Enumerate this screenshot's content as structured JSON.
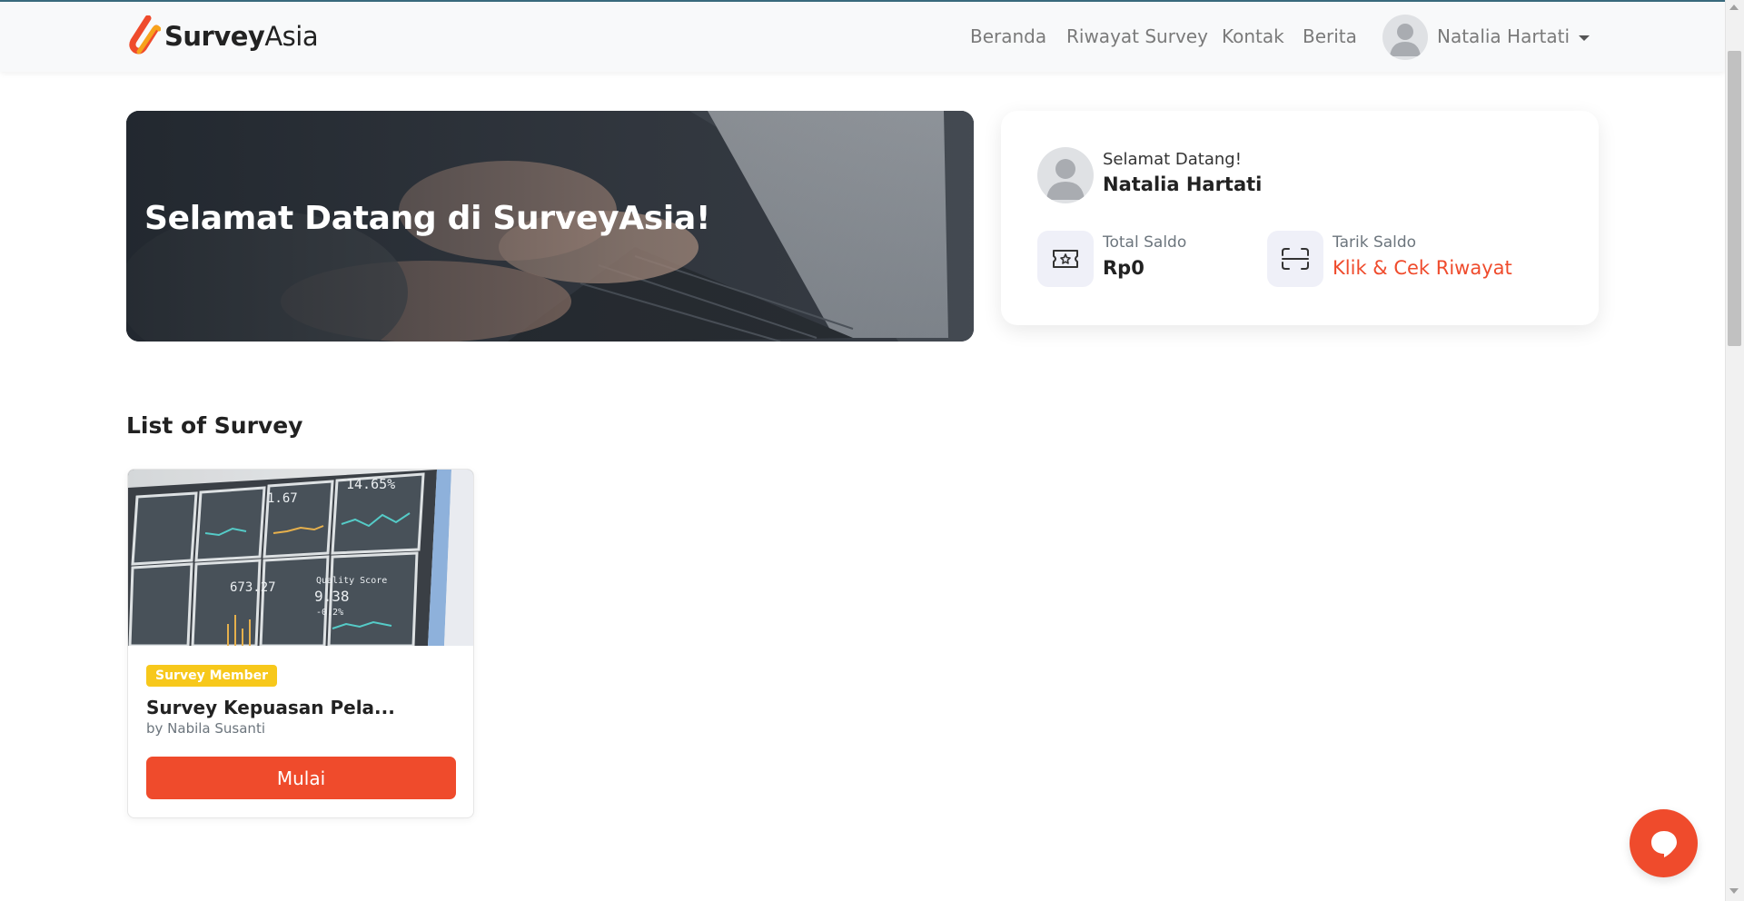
{
  "brand": {
    "bold": "Survey",
    "light": "Asia",
    "accent": "#ef4b2c"
  },
  "nav": {
    "links": [
      {
        "label": "Beranda"
      },
      {
        "label": "Riwayat Survey"
      },
      {
        "label": "Kontak"
      },
      {
        "label": "Berita"
      }
    ],
    "user_name": "Natalia Hartati",
    "avatar_icon": "user-avatar-icon",
    "dropdown_icon": "caret-down-icon"
  },
  "hero": {
    "title": "Selamat Datang di SurveyAsia!"
  },
  "welcome_card": {
    "greeting": "Selamat Datang!",
    "name": "Natalia Hartati",
    "balance": {
      "label": "Total Saldo",
      "value": "Rp0",
      "icon": "ticket-icon"
    },
    "withdraw": {
      "label": "Tarik Saldo",
      "link_text": "Klik & Cek Riwayat",
      "icon": "scan-icon"
    }
  },
  "list": {
    "title": "List of Survey",
    "surveys": [
      {
        "badge": "Survey Member",
        "title": "Survey Kepuasan Pela...",
        "author": "by Nabila Susanti",
        "button_label": "Mulai",
        "image_readouts": [
          "1.67",
          "14.65%",
          "673.27",
          "Quality Score",
          "9.38",
          "-0.2%"
        ]
      }
    ]
  },
  "chat": {
    "icon": "chat-bubble-icon"
  },
  "colors": {
    "accent": "#ef4b2c",
    "badge": "#f7c81b",
    "icon_bg": "#eff0f8"
  }
}
